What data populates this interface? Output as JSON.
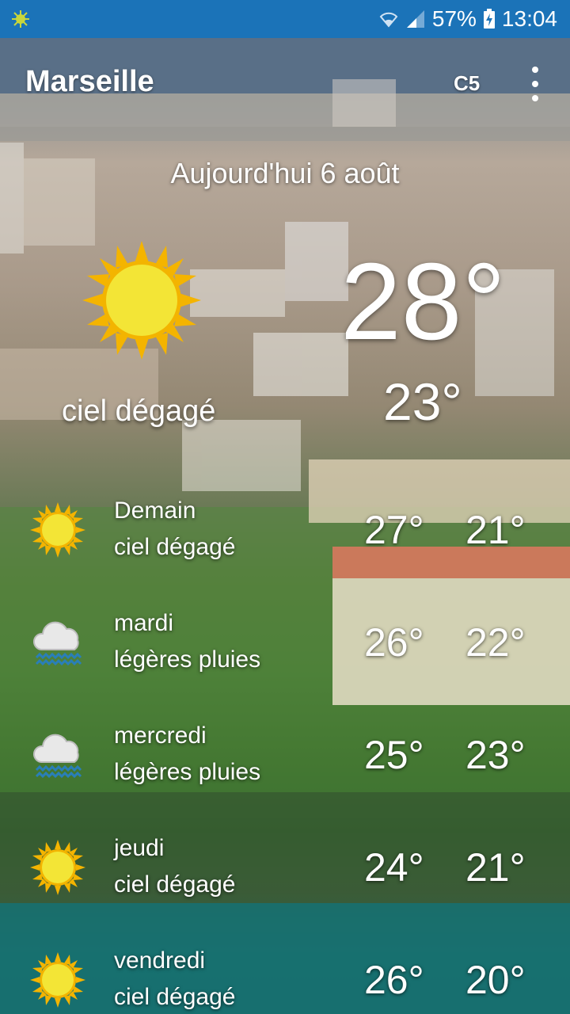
{
  "status_bar": {
    "battery": "57%",
    "time": "13:04",
    "icons": [
      "weather-sun-icon",
      "wifi-icon",
      "signal-icon",
      "battery-charging-icon"
    ]
  },
  "app_bar": {
    "city": "Marseille",
    "unit_label": "C5",
    "menu_icon": "more-vert-icon"
  },
  "today": {
    "date_label": "Aujourd'hui 6 août",
    "current_temp": "28°",
    "min_temp": "23°",
    "description": "ciel dégagé",
    "icon": "sun-icon"
  },
  "forecast": [
    {
      "day": "Demain",
      "desc": "ciel dégagé",
      "max": "27°",
      "min": "21°",
      "icon": "sun-icon"
    },
    {
      "day": "mardi",
      "desc": "légères pluies",
      "max": "26°",
      "min": "22°",
      "icon": "rain-cloud-icon"
    },
    {
      "day": "mercredi",
      "desc": "légères pluies",
      "max": "25°",
      "min": "23°",
      "icon": "rain-cloud-icon"
    },
    {
      "day": "jeudi",
      "desc": "ciel dégagé",
      "max": "24°",
      "min": "21°",
      "icon": "sun-icon"
    },
    {
      "day": "vendredi",
      "desc": "ciel dégagé",
      "max": "26°",
      "min": "20°",
      "icon": "sun-icon"
    }
  ],
  "colors": {
    "status_bar": "#1b73b8",
    "sun_fill": "#f3e536",
    "sun_rays": "#f4b400"
  }
}
